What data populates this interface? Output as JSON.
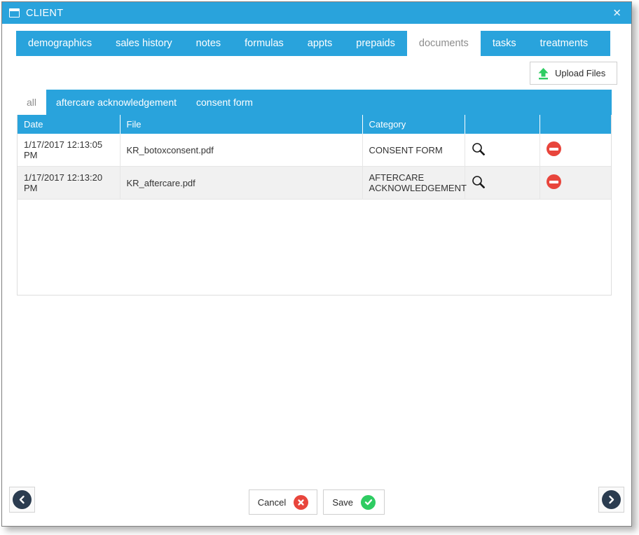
{
  "window": {
    "title": "CLIENT",
    "icon": "window-icon",
    "close_label": "✕"
  },
  "theme": {
    "accent_blue": "#29a3dc",
    "danger_red": "#e8453c",
    "success_green": "#2ecc62",
    "upload_green": "#2ecc62",
    "nav_navy": "#2b3c50",
    "row_alt_bg": "#f1f1f1"
  },
  "tabs": [
    {
      "label": "demographics",
      "active": false
    },
    {
      "label": "sales history",
      "active": false
    },
    {
      "label": "notes",
      "active": false
    },
    {
      "label": "formulas",
      "active": false
    },
    {
      "label": "appts",
      "active": false
    },
    {
      "label": "prepaids",
      "active": false
    },
    {
      "label": "documents",
      "active": true
    },
    {
      "label": "tasks",
      "active": false
    },
    {
      "label": "treatments",
      "active": false
    }
  ],
  "toolbar": {
    "upload_label": "Upload Files",
    "upload_icon": "upload-arrow-icon"
  },
  "subtabs": [
    {
      "label": "all",
      "active": true
    },
    {
      "label": "aftercare acknowledgement",
      "active": false
    },
    {
      "label": "consent form",
      "active": false
    }
  ],
  "grid": {
    "columns": [
      "Date",
      "File",
      "Category",
      "",
      ""
    ],
    "rows": [
      {
        "date": "1/17/2017 12:13:05 PM",
        "file": "KR_botoxconsent.pdf",
        "category": "CONSENT FORM",
        "view_icon": "magnifier-icon",
        "delete_icon": "delete-icon"
      },
      {
        "date": "1/17/2017 12:13:20 PM",
        "file": "KR_aftercare.pdf",
        "category": "AFTERCARE ACKNOWLEDGEMENT",
        "view_icon": "magnifier-icon",
        "delete_icon": "delete-icon"
      }
    ]
  },
  "footer": {
    "prev_icon": "chevron-left-icon",
    "next_icon": "chevron-right-icon",
    "cancel_label": "Cancel",
    "cancel_icon": "close-circle-icon",
    "save_label": "Save",
    "save_icon": "check-circle-icon"
  }
}
